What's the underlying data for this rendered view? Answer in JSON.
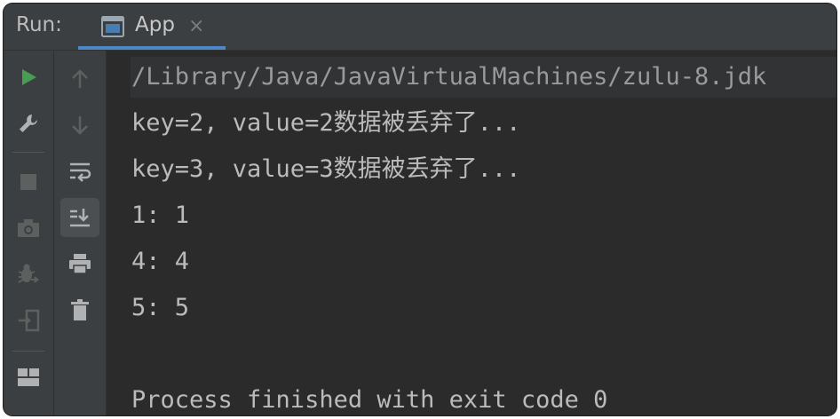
{
  "window": {
    "run_label": "Run:",
    "tab": {
      "label": "App",
      "close": "×",
      "icon": "console-window-icon"
    }
  },
  "toolbar_left": [
    "run-icon",
    "wrench-icon",
    "stop-icon",
    "camera-icon",
    "debug-icon",
    "exit-icon",
    "layout-icon"
  ],
  "toolbar_right": [
    "up-arrow-icon",
    "down-arrow-icon",
    "soft-wrap-icon",
    "scroll-to-end-icon",
    "print-icon",
    "trash-icon"
  ],
  "console": {
    "command": "/Library/Java/JavaVirtualMachines/zulu-8.jdk",
    "lines": [
      "key=2, value=2数据被丢弃了...",
      "key=3, value=3数据被丢弃了...",
      "1: 1",
      "4: 4",
      "5: 5",
      "",
      "Process finished with exit code 0"
    ]
  },
  "colors": {
    "run_green": "#499c54",
    "tab_underline": "#4a88c7",
    "console_bg": "#2b2b2b",
    "panel_bg": "#3c3f41"
  }
}
